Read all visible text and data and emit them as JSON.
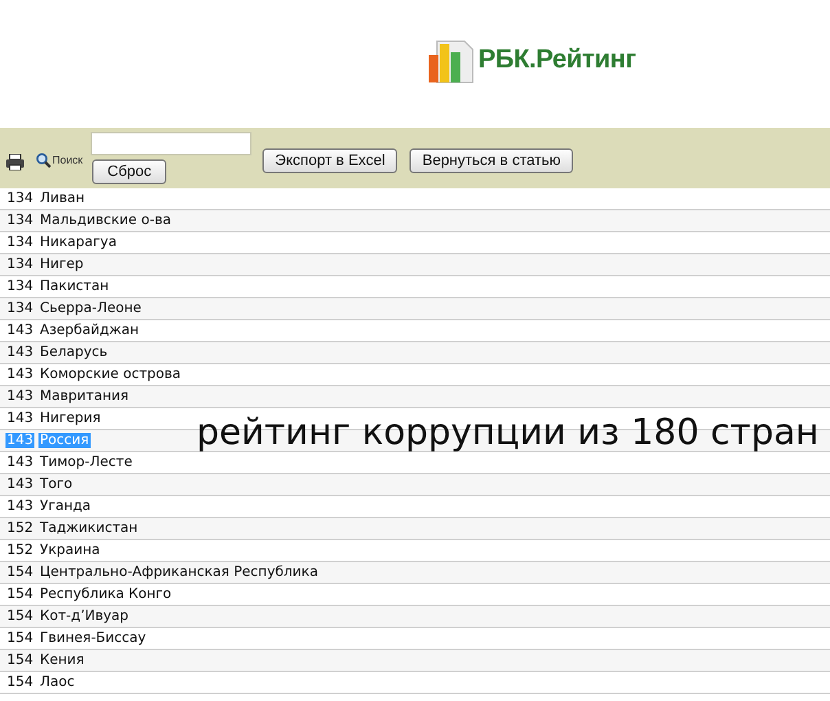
{
  "logo": {
    "text": "РБК.Рейтинг"
  },
  "toolbar": {
    "search_label": "Поиск",
    "reset_button": "Сброс",
    "buttons": [
      "Экспорт в Excel",
      "Вернуться в статью"
    ]
  },
  "rows": [
    {
      "rank": "134",
      "country": "Ливан",
      "selected": false
    },
    {
      "rank": "134",
      "country": "Мальдивские о-ва",
      "selected": false
    },
    {
      "rank": "134",
      "country": "Никарагуа",
      "selected": false
    },
    {
      "rank": "134",
      "country": "Нигер",
      "selected": false
    },
    {
      "rank": "134",
      "country": "Пакистан",
      "selected": false
    },
    {
      "rank": "134",
      "country": "Сьерра-Леоне",
      "selected": false
    },
    {
      "rank": "143",
      "country": "Азербайджан",
      "selected": false
    },
    {
      "rank": "143",
      "country": "Беларусь",
      "selected": false
    },
    {
      "rank": "143",
      "country": "Коморские острова",
      "selected": false
    },
    {
      "rank": "143",
      "country": "Мавритания",
      "selected": false
    },
    {
      "rank": "143",
      "country": "Нигерия",
      "selected": false
    },
    {
      "rank": "143",
      "country": "Россия",
      "selected": true
    },
    {
      "rank": "143",
      "country": "Тимор-Лесте",
      "selected": false
    },
    {
      "rank": "143",
      "country": "Того",
      "selected": false
    },
    {
      "rank": "143",
      "country": "Уганда",
      "selected": false
    },
    {
      "rank": "152",
      "country": "Таджикистан",
      "selected": false
    },
    {
      "rank": "152",
      "country": "Украина",
      "selected": false
    },
    {
      "rank": "154",
      "country": "Центрально-Африканская Республика",
      "selected": false
    },
    {
      "rank": "154",
      "country": "Республика Конго",
      "selected": false
    },
    {
      "rank": "154",
      "country": "Кот-д’Ивуар",
      "selected": false
    },
    {
      "rank": "154",
      "country": "Гвинея-Биссау",
      "selected": false
    },
    {
      "rank": "154",
      "country": "Кения",
      "selected": false
    },
    {
      "rank": "154",
      "country": "Лаос",
      "selected": false
    }
  ],
  "caption": "рейтинг коррупции из 180 стран"
}
